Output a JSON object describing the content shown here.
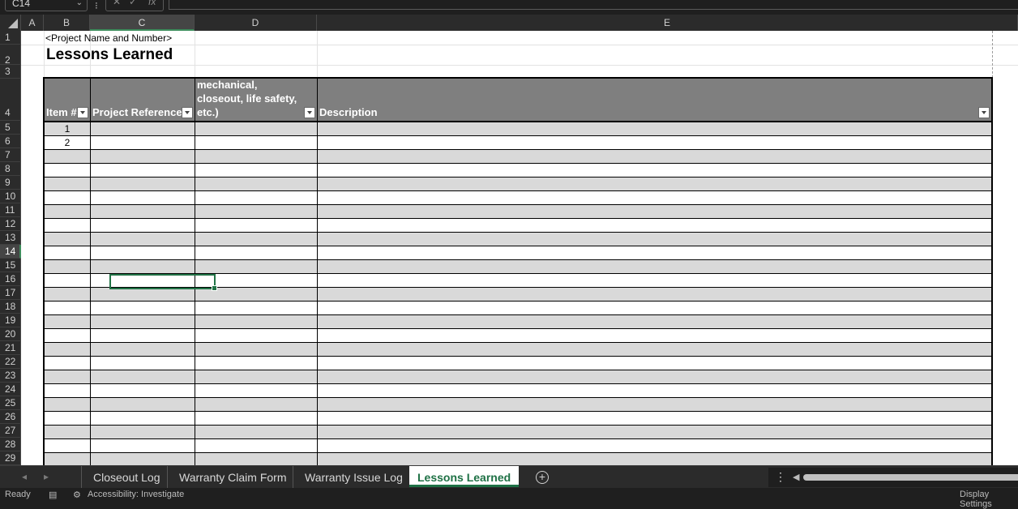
{
  "formula_bar": {
    "name_box": "C14",
    "fx_label": "fx",
    "cancel": "✕",
    "enter": "✓",
    "formula": ""
  },
  "columns": [
    "A",
    "B",
    "C",
    "D",
    "E"
  ],
  "rows": [
    "1",
    "2",
    "3",
    "4",
    "5",
    "6",
    "7",
    "8",
    "9",
    "10",
    "11",
    "12",
    "13",
    "14",
    "15",
    "16",
    "17",
    "18",
    "19",
    "20",
    "21",
    "22",
    "23",
    "24",
    "25",
    "26",
    "27",
    "28",
    "29"
  ],
  "selected_cell": {
    "column": "C",
    "row": "14"
  },
  "sheet": {
    "project_placeholder": "<Project Name and Number>",
    "title": "Lessons Learned",
    "table": {
      "headers": [
        {
          "label": "Item #"
        },
        {
          "label": "Project Reference"
        },
        {
          "label": "Topic (e.g., mechanical, closeout, life safety, etc.)"
        },
        {
          "label": "Description"
        }
      ],
      "item_numbers": [
        "1",
        "2"
      ]
    }
  },
  "tabs": [
    {
      "label": "Closeout Log",
      "active": false
    },
    {
      "label": "Warranty Claim Form",
      "active": false
    },
    {
      "label": "Warranty Issue Log",
      "active": false
    },
    {
      "label": "Lessons Learned",
      "active": true
    }
  ],
  "status": {
    "ready": "Ready",
    "accessibility": "Accessibility: Investigate",
    "display": "Display Settings"
  },
  "colors": {
    "header_fill": "#7f7f7f",
    "band_fill": "#d9d9d9",
    "selection": "#217346",
    "active_tab_text": "#1e7145"
  }
}
